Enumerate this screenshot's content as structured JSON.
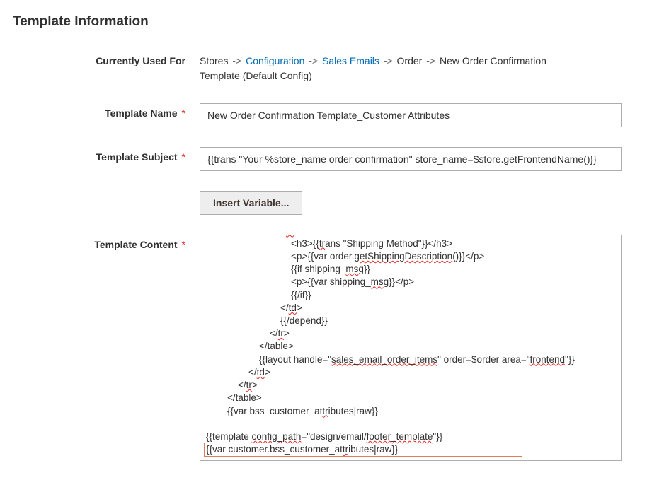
{
  "section_title": "Template Information",
  "labels": {
    "currently_used_for": "Currently Used For",
    "template_name": "Template Name",
    "template_subject": "Template Subject",
    "template_content": "Template Content"
  },
  "breadcrumb": {
    "prefix": "Stores",
    "link1": "Configuration",
    "link2": "Sales Emails",
    "suffix_line1": "Order",
    "suffix_line1b": "New Order Confirmation",
    "line2": "Template  (Default Config)"
  },
  "fields": {
    "template_name_value": "New Order Confirmation Template_Customer Attributes",
    "template_subject_value": "{{trans \"Your %store_name order confirmation\" store_name=$store.getFrontendName()}}"
  },
  "buttons": {
    "insert_variable": "Insert Variable..."
  },
  "template_content": "                            </td>\n                            {{depend order.getIsNotVirtual()}}\n                            <td class=\"method-info\">\n                                <h3>{{trans \"Shipping Method\"}}</h3>\n                                <p>{{var order.getShippingDescription()}}</p>\n                                {{if shipping_msg}}\n                                <p>{{var shipping_msg}}</p>\n                                {{/if}}\n                            </td>\n                            {{/depend}}\n                        </tr>\n                    </table>\n                    {{layout handle=\"sales_email_order_items\" order=$order area=\"frontend\"}}\n                </td>\n            </tr>\n        </table>\n        {{var bss_customer_attributes|raw}}\n\n{{template config_path=\"design/email/footer_template\"}}\n{{var customer.bss_customer_attributes|raw}}"
}
